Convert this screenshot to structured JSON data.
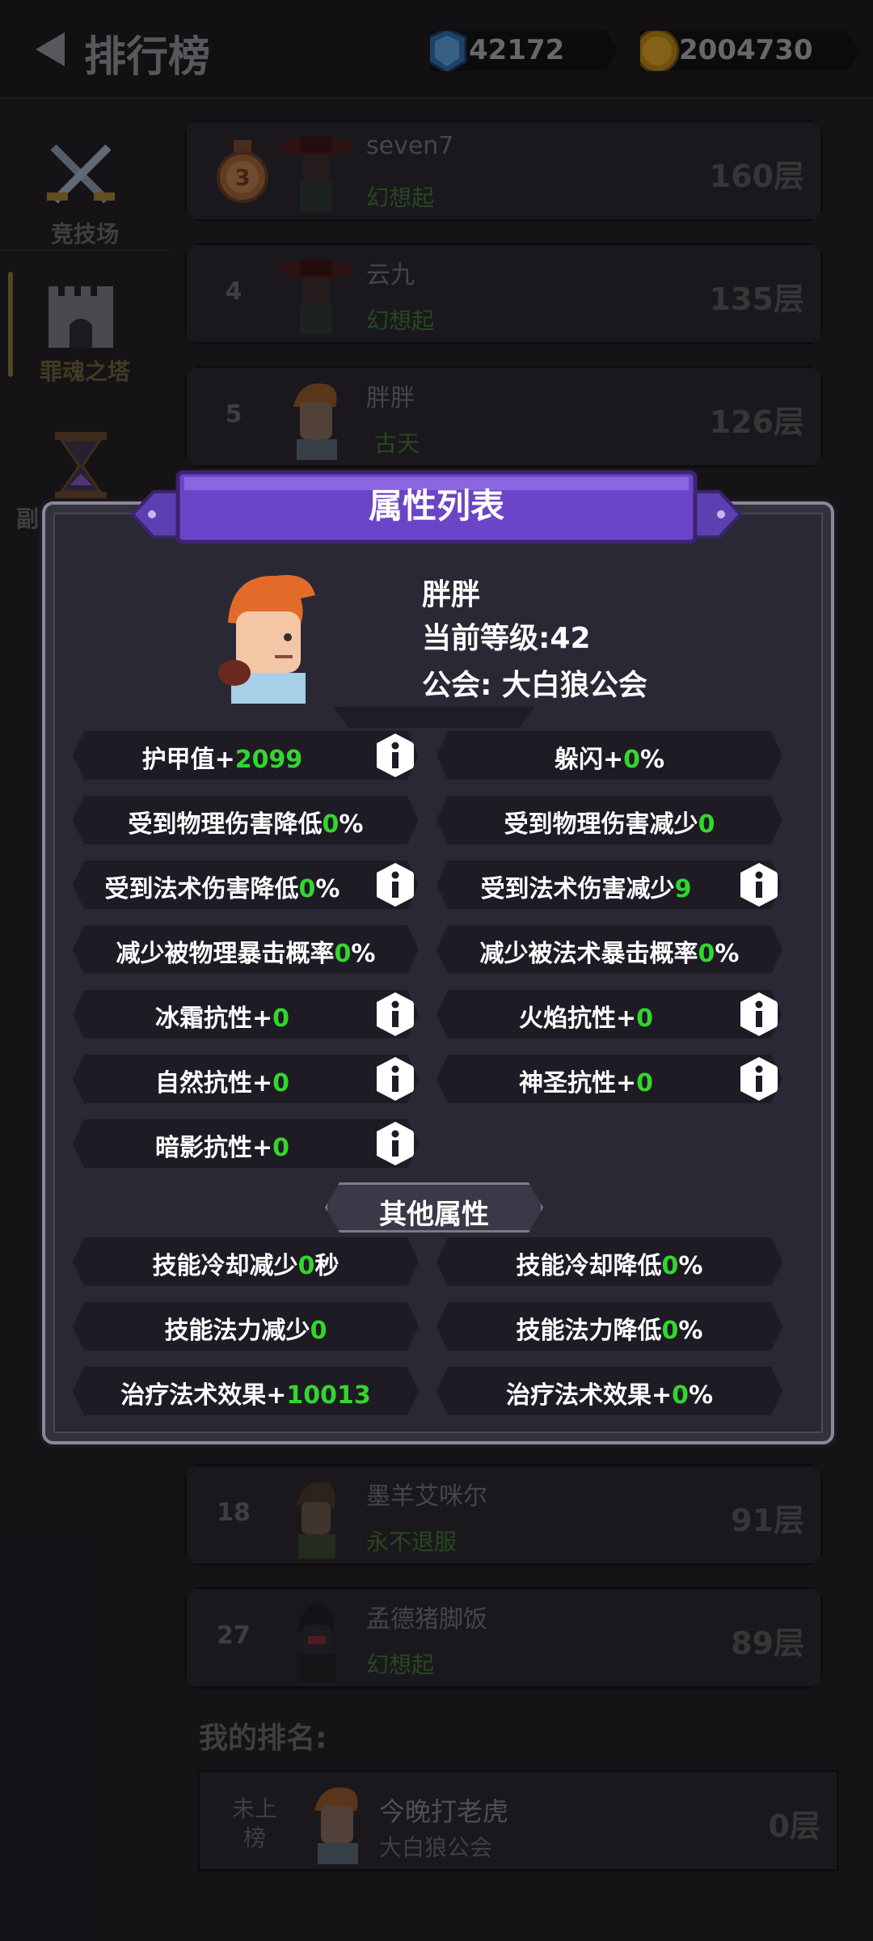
{
  "header": {
    "title": "排行榜",
    "gems": "42172",
    "coins": "2004730"
  },
  "side_tabs": [
    {
      "label": "竞技场",
      "icon": "crossed-swords-icon"
    },
    {
      "label": "罪魂之塔",
      "icon": "tower-icon"
    },
    {
      "label": "副",
      "icon": "hourglass-icon"
    }
  ],
  "rankings": [
    {
      "rank": "3",
      "name": "seven7",
      "guild": "幻想起",
      "floor": "160层"
    },
    {
      "rank": "4",
      "name": "云九",
      "guild": "幻想起",
      "floor": "135层"
    },
    {
      "rank": "5",
      "name": "胖胖",
      "guild": "古天",
      "floor": "126层"
    },
    {
      "rank": "18",
      "name": "墨羊艾咪尔",
      "guild": "永不退服",
      "floor": "91层"
    },
    {
      "rank": "27",
      "name": "孟德猪脚饭",
      "guild": "幻想起",
      "floor": "89层"
    }
  ],
  "my_rank": {
    "title": "我的排名:",
    "status": "未上榜",
    "name": "今晚打老虎",
    "guild": "大白狼公会",
    "floor": "0层"
  },
  "modal": {
    "title": "属性列表",
    "player_name": "胖胖",
    "level_text": "当前等级:42",
    "guild_text": "公会: 大白狼公会",
    "other_header": "其他属性",
    "stats": [
      {
        "label": "护甲值+",
        "value": "2099",
        "suffix": "",
        "info": true
      },
      {
        "label": "躲闪+",
        "value": "0",
        "suffix": "%",
        "info": false
      },
      {
        "label": "受到物理伤害降低",
        "value": "0",
        "suffix": "%",
        "info": false
      },
      {
        "label": "受到物理伤害减少",
        "value": "0",
        "suffix": "",
        "info": false
      },
      {
        "label": "受到法术伤害降低",
        "value": "0",
        "suffix": "%",
        "info": true
      },
      {
        "label": "受到法术伤害减少",
        "value": "9",
        "suffix": "",
        "info": true
      },
      {
        "label": "减少被物理暴击概率",
        "value": "0",
        "suffix": "%",
        "info": false
      },
      {
        "label": "减少被法术暴击概率",
        "value": "0",
        "suffix": "%",
        "info": false
      },
      {
        "label": "冰霜抗性+",
        "value": "0",
        "suffix": "",
        "info": true
      },
      {
        "label": "火焰抗性+",
        "value": "0",
        "suffix": "",
        "info": true
      },
      {
        "label": "自然抗性+",
        "value": "0",
        "suffix": "",
        "info": true
      },
      {
        "label": "神圣抗性+",
        "value": "0",
        "suffix": "",
        "info": true
      },
      {
        "label": "暗影抗性+",
        "value": "0",
        "suffix": "",
        "info": true
      }
    ],
    "other_stats": [
      {
        "label": "技能冷却减少",
        "value": "0",
        "suffix": "秒"
      },
      {
        "label": "技能冷却降低",
        "value": "0",
        "suffix": "%"
      },
      {
        "label": "技能法力减少",
        "value": "0",
        "suffix": ""
      },
      {
        "label": "技能法力降低",
        "value": "0",
        "suffix": "%"
      },
      {
        "label": "治疗法术效果+",
        "value": "10013",
        "suffix": ""
      },
      {
        "label": "治疗法术效果+",
        "value": "0",
        "suffix": "%"
      }
    ]
  },
  "colors": {
    "accent_purple": "#6b45c8",
    "value_green": "#33d62e",
    "guild_green": "#3d7d2f"
  }
}
